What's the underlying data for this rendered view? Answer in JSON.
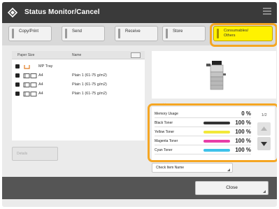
{
  "window": {
    "title": "Status Monitor/Cancel"
  },
  "tabs": [
    {
      "label": "Copy/Print"
    },
    {
      "label": "Send"
    },
    {
      "label": "Receive"
    },
    {
      "label": "Store"
    },
    {
      "label_line1": "Consumables/",
      "label_line2": "Others",
      "active": true
    }
  ],
  "paper_list": {
    "col_paper_size": "Paper Size",
    "col_name": "Name",
    "rows": [
      {
        "size": "MP Tray",
        "name": ""
      },
      {
        "size": "A4",
        "name": "Plain 1 (61-75 g/m2)"
      },
      {
        "size": "A4",
        "name": "Plain 1 (61-75 g/m2)"
      },
      {
        "size": "A4",
        "name": "Plain 1 (61-75 g/m2)"
      }
    ]
  },
  "details_button": {
    "label": "Details"
  },
  "consumables": {
    "page": "1/2",
    "rows": [
      {
        "label": "Memory Usage",
        "value": "0 %",
        "color": ""
      },
      {
        "label": "Black Toner",
        "value": "100 %",
        "color": "#333333"
      },
      {
        "label": "Yellow Toner",
        "value": "100 %",
        "color": "#f2e83a"
      },
      {
        "label": "Magenta Toner",
        "value": "100 %",
        "color": "#e83ea8"
      },
      {
        "label": "Cyan Toner",
        "value": "100 %",
        "color": "#3ec2ea"
      }
    ]
  },
  "check_item_button": {
    "label": "Check Item Name"
  },
  "close_button": {
    "label": "Close"
  },
  "colors": {
    "title_bar": "#3a3a3a",
    "active_tab": "#fff200",
    "focus_ring": "#f5a623"
  }
}
